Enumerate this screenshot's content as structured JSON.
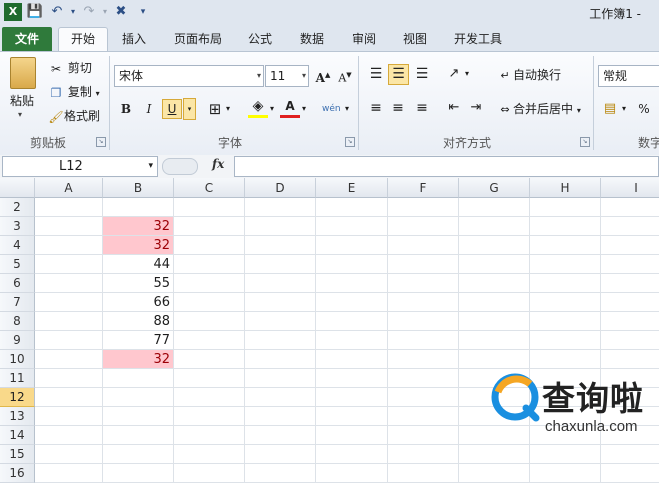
{
  "window": {
    "title": "工作簿1 -"
  },
  "quick_access": {
    "undo_icon": "undo-icon",
    "redo_icon": "redo-icon"
  },
  "tabs": [
    "文件",
    "开始",
    "插入",
    "页面布局",
    "公式",
    "数据",
    "审阅",
    "视图",
    "开发工具"
  ],
  "active_tab": "开始",
  "clipboard": {
    "paste": "粘贴",
    "cut": "剪切",
    "copy": "复制",
    "format_painter": "格式刷",
    "group_label": "剪贴板"
  },
  "font": {
    "name": "宋体",
    "size": "11",
    "bold": "B",
    "italic": "I",
    "underline": "U",
    "phonetic": "wén",
    "group_label": "字体"
  },
  "alignment": {
    "wrap_text": "自动换行",
    "merge_center": "合并后居中",
    "group_label": "对齐方式"
  },
  "number": {
    "format": "常规",
    "percent": "%",
    "group_label": "数字"
  },
  "formula_bar": {
    "name_box": "L12",
    "fx": "fx",
    "content": ""
  },
  "grid": {
    "columns": [
      "A",
      "B",
      "C",
      "D",
      "E",
      "F",
      "G",
      "H",
      "I"
    ],
    "rows": [
      "2",
      "3",
      "4",
      "5",
      "6",
      "7",
      "8",
      "9",
      "10",
      "11",
      "12",
      "13",
      "14",
      "15",
      "16"
    ],
    "selected_row": "12",
    "b_values": [
      "",
      "32",
      "32",
      "44",
      "55",
      "66",
      "88",
      "77",
      "32",
      "",
      "",
      "",
      "",
      "",
      ""
    ],
    "highlighted_rows": [
      "3",
      "4",
      "10"
    ],
    "highlight_fill": "#ffc7ce",
    "highlight_text": "#9c0006"
  },
  "watermark": {
    "text": "查询啦",
    "url": "chaxunla.com"
  },
  "colors": {
    "file_tab": "#2f7a3b",
    "selected_row_header": "#f9d98a"
  }
}
